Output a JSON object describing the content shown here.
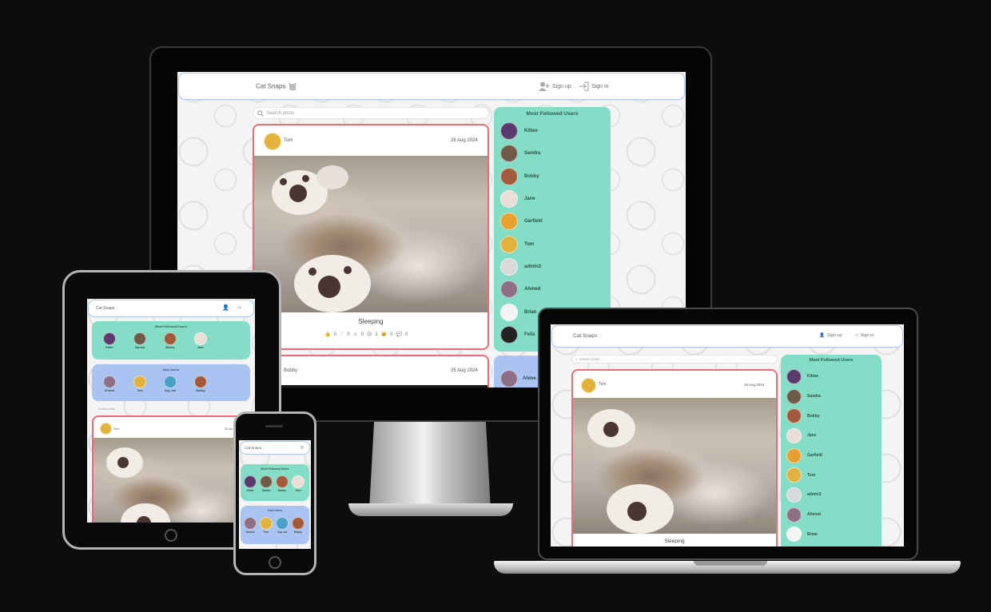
{
  "app": {
    "brand": "Cat Snaps"
  },
  "nav": {
    "signup": "Sign up",
    "signin": "Sign in"
  },
  "search": {
    "placeholder": "Search posts"
  },
  "most_followed": {
    "title": "Most Followed Users",
    "users": [
      {
        "name": "Kittee",
        "color": "#5b3a6e"
      },
      {
        "name": "Sandra",
        "color": "#6f5a48"
      },
      {
        "name": "Bobby",
        "color": "#a35a3a"
      },
      {
        "name": "Jane",
        "color": "#e9ddd5"
      },
      {
        "name": "Garfield",
        "color": "#e8a12e"
      },
      {
        "name": "Tom",
        "color": "#e3b23c"
      },
      {
        "name": "admin3",
        "color": "#d9d9d9"
      },
      {
        "name": "Ahmed",
        "color": "#8e6f86"
      },
      {
        "name": "Brian",
        "color": "#f4f4f4"
      },
      {
        "name": "Felix",
        "color": "#222222"
      }
    ],
    "cut_user": "Ahme"
  },
  "new_users": {
    "title": "New Users",
    "users": [
      {
        "name": "Ahmed",
        "color": "#8e6f86"
      },
      {
        "name": "Tom",
        "color": "#e3b23c"
      },
      {
        "name": "kop_cat",
        "color": "#4aa0c8"
      },
      {
        "name": "Bobby",
        "color": "#a35a3a"
      }
    ]
  },
  "posts": [
    {
      "author": "Tom",
      "date": "26 Aug 2024",
      "title": "Sleeping",
      "reactions": {
        "like": "0",
        "love": "0",
        "laugh": "0",
        "sad": "1",
        "cat": "0",
        "comments": "0"
      }
    },
    {
      "author": "Bobby",
      "date": "26 Aug 2024"
    }
  ],
  "post_date_cut": "26 Au",
  "colors": {
    "accent_red": "#ec6b78",
    "panel_green": "#84ddc6",
    "panel_blue": "#a9c3f3"
  },
  "icons": [
    "cat-logo-icon",
    "add-user-icon",
    "sign-in-icon",
    "search-icon",
    "menu-icon",
    "like-icon",
    "love-icon",
    "laugh-icon",
    "sad-icon",
    "cat-face-icon",
    "comment-icon"
  ]
}
